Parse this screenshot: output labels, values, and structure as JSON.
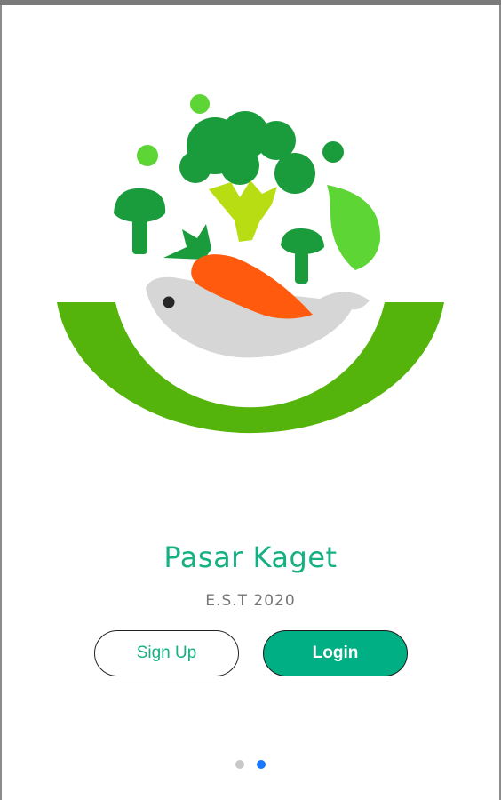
{
  "app": {
    "name": "Pasar Kaget",
    "tagline": "E.S.T 2020"
  },
  "actions": {
    "signup_label": "Sign Up",
    "login_label": "Login"
  },
  "pager": {
    "total": 2,
    "active_index": 1
  },
  "colors": {
    "brand_teal": "#16b083",
    "login_fill": "#00b084",
    "bowl_green": "#55b40b",
    "broccoli_dark": "#1b9c3c",
    "broccoli_light": "#5cd535",
    "stalk_lime": "#b8dd12",
    "carrot_orange": "#ff5a0e",
    "fish_grey": "#d6d6d6",
    "dot_active": "#1677ff",
    "dot_inactive": "#c8c8c8"
  },
  "icons": {
    "logo": "grocery-bowl-logo"
  }
}
